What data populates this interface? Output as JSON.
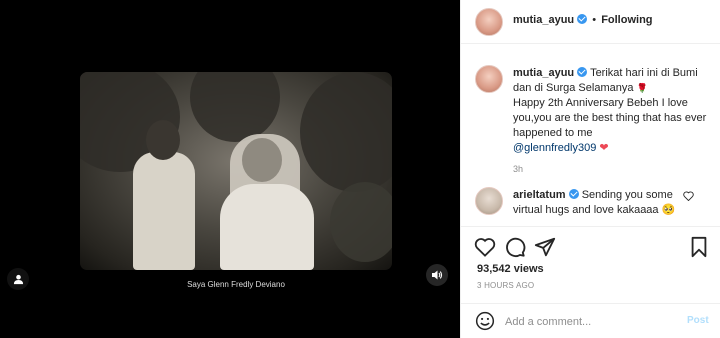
{
  "video": {
    "subtitle": "Saya Glenn Fredly Deviano"
  },
  "header": {
    "username": "mutia_ayuu",
    "separator": "•",
    "follow_status": "Following"
  },
  "caption": {
    "username": "mutia_ayuu",
    "text_part1": "Terikat hari ini di Bumi dan di Surga Selamanya",
    "text_part2": "Happy 2th Anniversary Bebeh I love you,you are the best thing that has ever happened to me",
    "mention": "@glennfredly309",
    "time": "3h"
  },
  "comments": [
    {
      "username": "arieltatum",
      "text": "Sending you some virtual hugs and love kakaaaa",
      "emoji": "🥺",
      "heart": "♥"
    }
  ],
  "stats": {
    "views": "93,542 views",
    "posted": "3 HOURS AGO"
  },
  "add_comment": {
    "placeholder": "Add a comment...",
    "post_label": "Post"
  },
  "icons": {
    "verified": "verified-badge-icon",
    "rose": "🌹",
    "heart": "❤"
  },
  "colors": {
    "verified": "#3897f0",
    "mention": "#00376b",
    "heart": "#ed4956",
    "post_disabled": "#b2dffc"
  }
}
